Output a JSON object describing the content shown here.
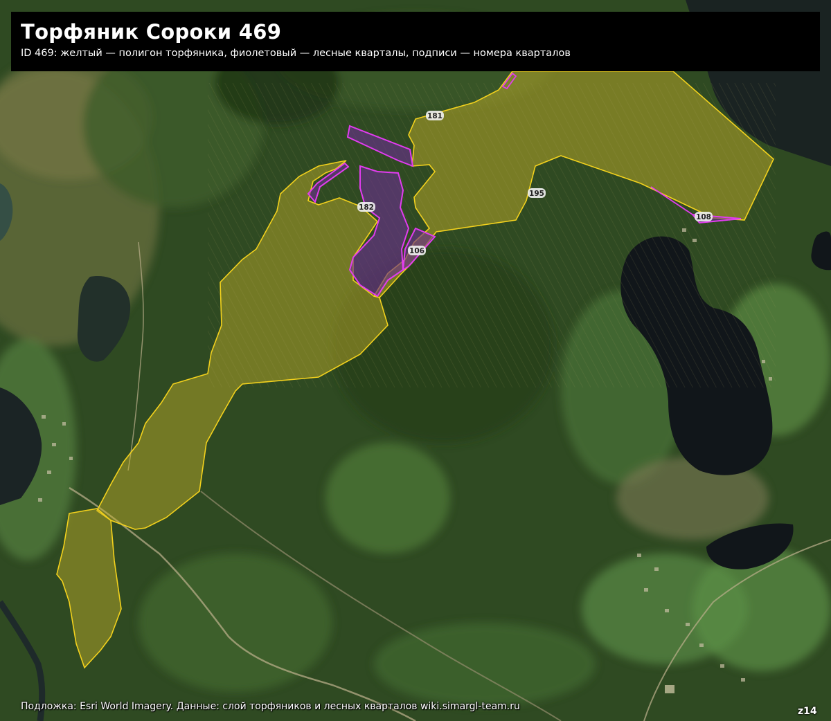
{
  "title": "Торфяник Сороки 469",
  "subtitle": "ID 469: желтый — полигон торфяника, фиолетовый — лесные кварталы, подписи — номера кварталов",
  "attribution": "Подложка: Esri World Imagery. Данные: слой торфяников и лесных кварталов wiki.simargl-team.ru",
  "zoom_label": "z14",
  "colors": {
    "peat_outline": "#f4d21c",
    "peat_fill": "#c8b42a",
    "quarter_outline": "#e23cf0",
    "quarter_fill": "#7a3a9a",
    "water": "#11161a",
    "forest": "#2f4a22"
  },
  "quarters": [
    {
      "number": "181"
    },
    {
      "number": "182"
    },
    {
      "number": "195"
    },
    {
      "number": "106"
    },
    {
      "number": "108"
    }
  ]
}
